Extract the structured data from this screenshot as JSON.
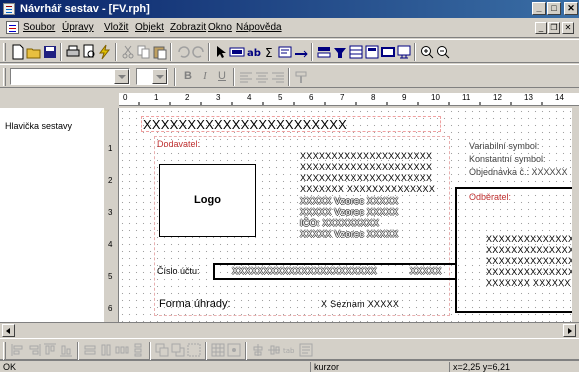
{
  "window": {
    "title": "Návrhář sestav - [FV.rph]",
    "min": "_",
    "max": "□",
    "close": "✕"
  },
  "menu": {
    "items": [
      "Soubor",
      "Úpravy",
      "Vložit",
      "Objekt",
      "Zobrazit",
      "Okno",
      "Nápověda"
    ],
    "mdi_min": "_",
    "mdi_restore": "❐",
    "mdi_close": "✕"
  },
  "toolbar2": {
    "bold": "B",
    "italic": "I",
    "underline": "U"
  },
  "ruler": {
    "h_ticks": [
      "0",
      "1",
      "2",
      "3",
      "4",
      "5",
      "6",
      "7",
      "8",
      "9",
      "10",
      "11",
      "12",
      "13",
      "14"
    ],
    "v_ticks": [
      "1",
      "2",
      "3",
      "4",
      "5",
      "6"
    ]
  },
  "sections": {
    "header_label": "Hlavička sestavy"
  },
  "report": {
    "title_placeholder": "XXXXXXXXXXXXXXXXXXXXXXX",
    "supplier_label": "Dodavatel:",
    "logo_label": "Logo",
    "supplier_lines": [
      "XXXXXXXXXXXXXXXXXXXXX",
      "XXXXXXXXXXXXXXXXXXXXX",
      "XXXXXXXXXXXXXXXXXXXXX",
      "XXXXXXX XXXXXXXXXXXXXX"
    ],
    "supplier_fields": [
      "XXXXX Vzorec XXXXX",
      "XXXXX Vzorec XXXXX",
      "IČO: XXXXXXXXX",
      "XXXXX Vzorec XXXXX"
    ],
    "variable_symbol": "Variabilní symbol:",
    "constant_symbol": "Konstantní symbol:",
    "order_no": "Objednávka č.: XXXXXX",
    "customer_label": "Odběratel:",
    "customer_lines": [
      "XXXXXXXXXXXXXX",
      "XXXXXXXXXXXXXX",
      "XXXXXXXXXXXXXX",
      "XXXXXXXXXXXXXX",
      "XXXXXXX XXXXXX"
    ],
    "account_label": "Číslo účtu:",
    "account_value": "XXXXXXXXXXXXXXXXXXXXXXX",
    "account_code": "XXXXX",
    "payment_label": "Forma úhrady:",
    "payment_value": "X Seznam XXXXX"
  },
  "status": {
    "text": "OK",
    "mode": "kurzor",
    "coords": "x=2,25  y=6,21"
  }
}
